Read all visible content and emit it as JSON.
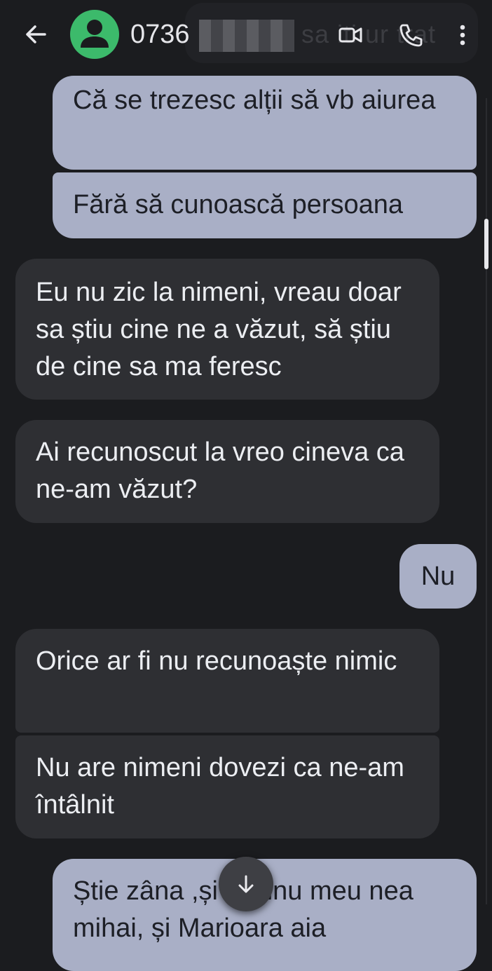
{
  "header": {
    "title": "0736",
    "hidden_text": "sa iti ur trat",
    "back_icon": "arrow-left-icon",
    "video_icon": "video-call-icon",
    "phone_icon": "phone-icon",
    "menu_icon": "more-vert-icon",
    "avatar_color": "#3cba6b"
  },
  "messages": [
    {
      "direction": "outgoing",
      "text": "Că se trezesc alții să vb aiurea"
    },
    {
      "direction": "outgoing",
      "text": "Fără să cunoască persoana"
    },
    {
      "direction": "incoming",
      "text": "Eu nu zic la nimeni, vreau doar sa știu cine ne a văzut, să știu de cine sa ma feresc"
    },
    {
      "direction": "incoming",
      "text": "Ai recunoscut la vreo cineva ca ne-am văzut?"
    },
    {
      "direction": "outgoing",
      "text": "Nu"
    },
    {
      "direction": "incoming",
      "text": "Orice ar fi nu recunoaște nimic"
    },
    {
      "direction": "incoming",
      "text": "Nu are nimeni dovezi ca ne-am întâlnit"
    },
    {
      "direction": "outgoing",
      "text": "Știe zâna ,și vecinu meu nea mihai, și Marioara aia"
    }
  ],
  "scroll_down_icon": "arrow-down-icon",
  "colors": {
    "background": "#1b1c1f",
    "outgoing_bubble": "#a9afc6",
    "incoming_bubble": "#2e2f33"
  }
}
